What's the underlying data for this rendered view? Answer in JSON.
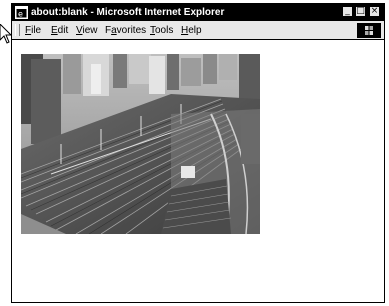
{
  "window": {
    "title": "about:blank - Microsoft Internet Explorer",
    "controls": {
      "minimize": "_",
      "maximize": "□",
      "close": "×"
    }
  },
  "menu": {
    "items": [
      {
        "acc": "F",
        "rest": "ile"
      },
      {
        "acc": "E",
        "rest": "dit"
      },
      {
        "acc": "V",
        "rest": "iew"
      },
      {
        "pre": "F",
        "acc": "a",
        "rest": "vorites"
      },
      {
        "acc": "T",
        "rest": "ools"
      },
      {
        "acc": "H",
        "rest": "elp"
      }
    ]
  },
  "content": {
    "image": {
      "subject": "aerial grayscale photo of city rail yard with many tracks and buildings"
    }
  },
  "icons": [
    "ie-window-icon",
    "windows-logo-icon",
    "mouse-cursor-icon"
  ]
}
